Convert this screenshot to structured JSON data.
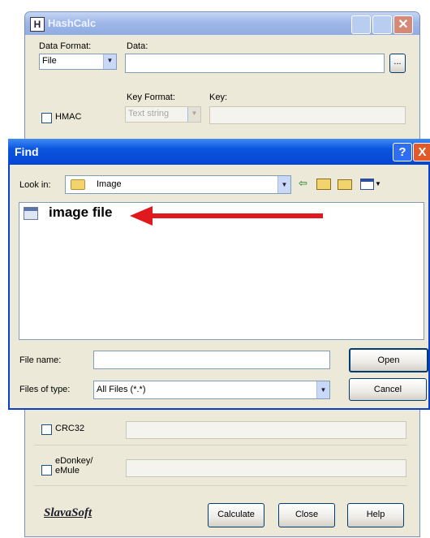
{
  "hashcalc": {
    "title": "HashCalc",
    "app_icon_letter": "H",
    "data_format_label": "Data Format:",
    "data_format_value": "File",
    "data_label": "Data:",
    "browse_label": "...",
    "hmac_label": "HMAC",
    "key_format_label": "Key Format:",
    "key_format_value": "Text string",
    "key_label": "Key:",
    "crc32_label": "CRC32",
    "edonkey_label_1": "eDonkey/",
    "edonkey_label_2": "eMule",
    "brand": "SlavaSoft",
    "calculate_label": "Calculate",
    "close_label": "Close",
    "help_label": "Help"
  },
  "find": {
    "title": "Find",
    "help_glyph": "?",
    "close_glyph": "X",
    "look_in_label": "Look in:",
    "look_in_value": "Image",
    "file_item_label": "image file",
    "file_name_label": "File name:",
    "file_name_value": "",
    "files_of_type_label": "Files of type:",
    "files_of_type_value": "All Files (*.*)",
    "open_label": "Open",
    "cancel_label": "Cancel"
  },
  "colors": {
    "annotation_arrow": "#e0191f",
    "find_title_bar": "#0a55df"
  }
}
